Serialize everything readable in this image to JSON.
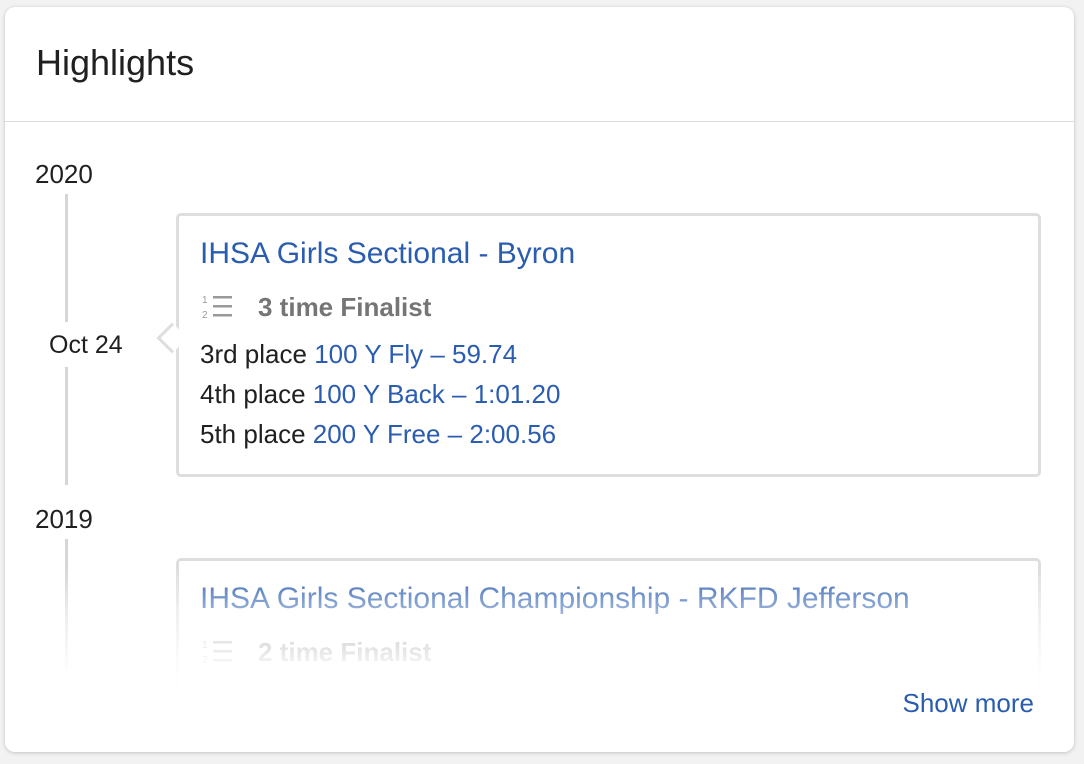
{
  "header": {
    "title": "Highlights"
  },
  "timeline": [
    {
      "year": "2020",
      "events": [
        {
          "date": "Oct 24",
          "title": "IHSA Girls Sectional - Byron",
          "finalist": "3 time Finalist",
          "results": [
            {
              "place": "3rd place",
              "event": "100 Y Fly – 59.74"
            },
            {
              "place": "4th place",
              "event": "100 Y Back – 1:01.20"
            },
            {
              "place": "5th place",
              "event": "200 Y Free – 2:00.56"
            }
          ]
        }
      ]
    },
    {
      "year": "2019",
      "events": [
        {
          "title": "IHSA Girls Sectional Championship - RKFD Jefferson",
          "finalist": "2 time Finalist"
        }
      ]
    }
  ],
  "footer": {
    "show_more": "Show more"
  },
  "colors": {
    "link": "#2a5db0",
    "text": "#202020",
    "muted": "#757575",
    "border": "#dedede"
  },
  "icons": {
    "finalist": "ordered-list-icon"
  }
}
